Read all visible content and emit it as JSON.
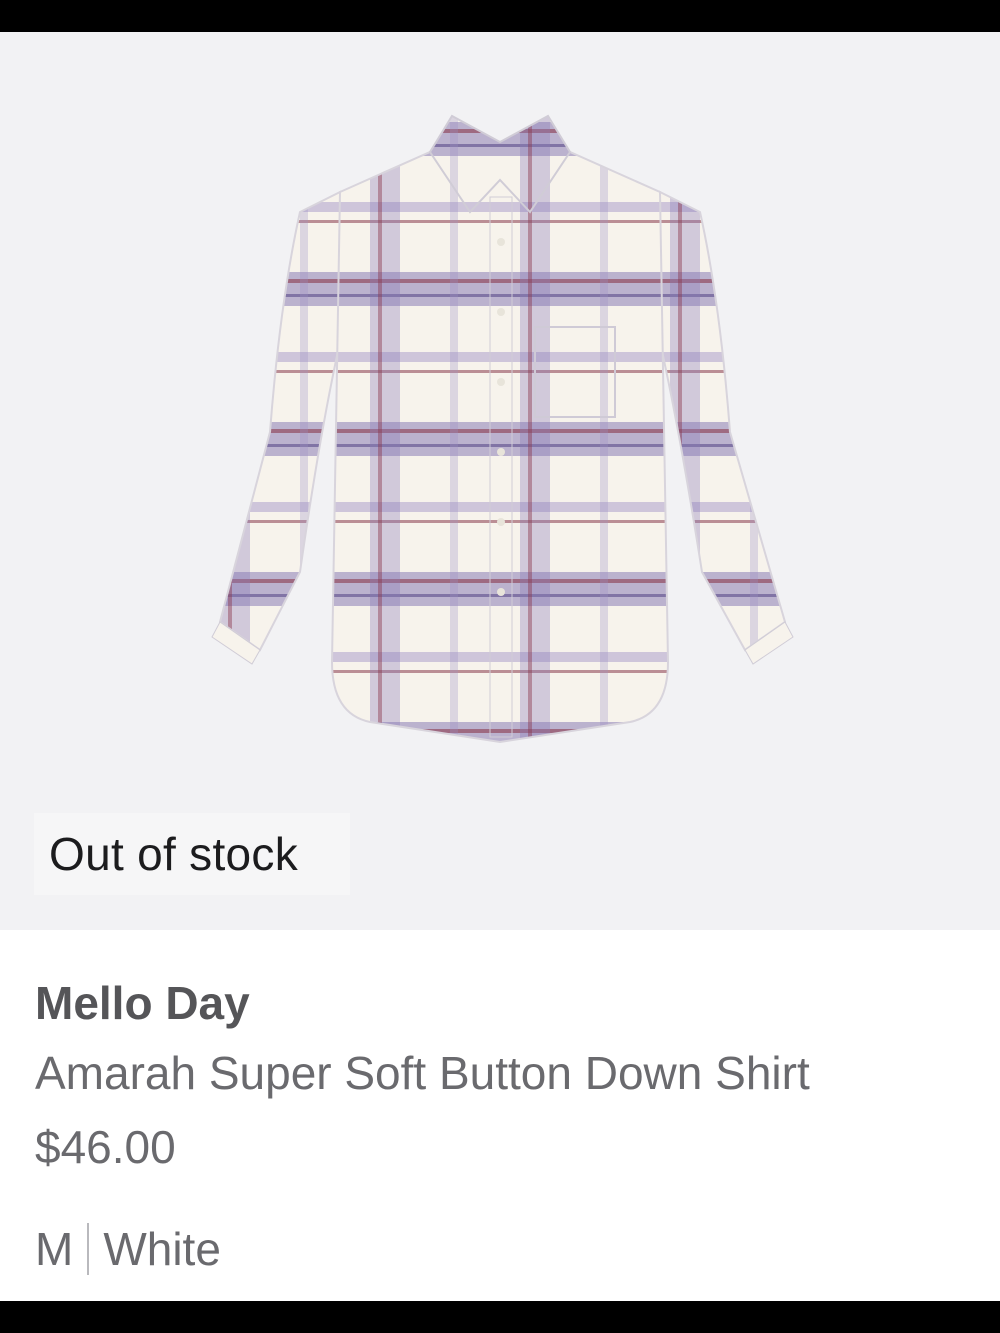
{
  "product": {
    "badge": "Out of stock",
    "brand": "Mello Day",
    "name": "Amarah Super Soft Button Down Shirt",
    "price": "$46.00",
    "size": "M",
    "color": "White",
    "image_icon": "plaid-shirt-image"
  },
  "colors": {
    "background": "#f2f2f4",
    "plaid_purple": "#7b6aa8",
    "plaid_burgundy": "#8b3a4e",
    "plaid_white": "#f7f3ec"
  }
}
